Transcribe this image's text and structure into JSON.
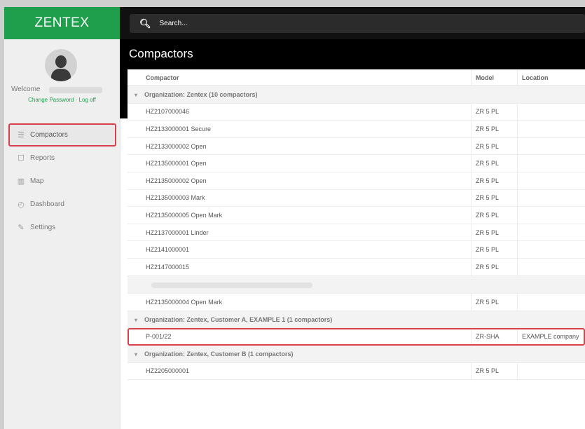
{
  "brand": "ZENTEX",
  "user": {
    "welcome": "Welcome",
    "change_password": "Change Password",
    "separator": " · ",
    "log_off": "Log off"
  },
  "nav": [
    {
      "label": "Compactors",
      "icon": "list-icon",
      "glyph": "☰"
    },
    {
      "label": "Reports",
      "icon": "document-icon",
      "glyph": "☐"
    },
    {
      "label": "Map",
      "icon": "map-icon",
      "glyph": "▥"
    },
    {
      "label": "Dashboard",
      "icon": "gauge-icon",
      "glyph": "◴"
    },
    {
      "label": "Settings",
      "icon": "wrench-icon",
      "glyph": "✎"
    }
  ],
  "search": {
    "placeholder": "Search..."
  },
  "page_title": "Compactors",
  "table": {
    "headers": {
      "compactor": "Compactor",
      "model": "Model",
      "location": "Location"
    },
    "group1": {
      "label": "Organization: Zentex (10 compactors)",
      "rows": [
        {
          "compactor": "HZ2107000046",
          "model": "ZR 5 PL",
          "location": ""
        },
        {
          "compactor": "HZ2133000001 Secure",
          "model": "ZR 5 PL",
          "location": ""
        },
        {
          "compactor": "HZ2133000002 Open",
          "model": "ZR 5 PL",
          "location": ""
        },
        {
          "compactor": "HZ2135000001 Open",
          "model": "ZR 5 PL",
          "location": ""
        },
        {
          "compactor": "HZ2135000002 Open",
          "model": "ZR 5 PL",
          "location": ""
        },
        {
          "compactor": "HZ2135000003 Mark",
          "model": "ZR 5 PL",
          "location": ""
        },
        {
          "compactor": "HZ2135000005 Open Mark",
          "model": "ZR 5 PL",
          "location": ""
        },
        {
          "compactor": "HZ2137000001 Linder",
          "model": "ZR 5 PL",
          "location": ""
        },
        {
          "compactor": "HZ2141000001",
          "model": "ZR 5 PL",
          "location": ""
        },
        {
          "compactor": "HZ2147000015",
          "model": "ZR 5 PL",
          "location": ""
        }
      ]
    },
    "extra_row": {
      "compactor": "HZ2135000004 Open Mark",
      "model": "ZR 5 PL",
      "location": ""
    },
    "group2": {
      "label": "Organization: Zentex, Customer A, EXAMPLE 1 (1 compactors)",
      "rows": [
        {
          "compactor": "P-001/22",
          "model": "ZR-SHA",
          "location": "EXAMPLE company"
        }
      ]
    },
    "group3": {
      "label": "Organization: Zentex, Customer B (1 compactors)",
      "rows": [
        {
          "compactor": "HZ2205000001",
          "model": "ZR 5 PL",
          "location": ""
        }
      ]
    }
  },
  "colors": {
    "brand_green": "#1f9e4c",
    "highlight_red": "#d9414a",
    "topbar": "#111111"
  }
}
